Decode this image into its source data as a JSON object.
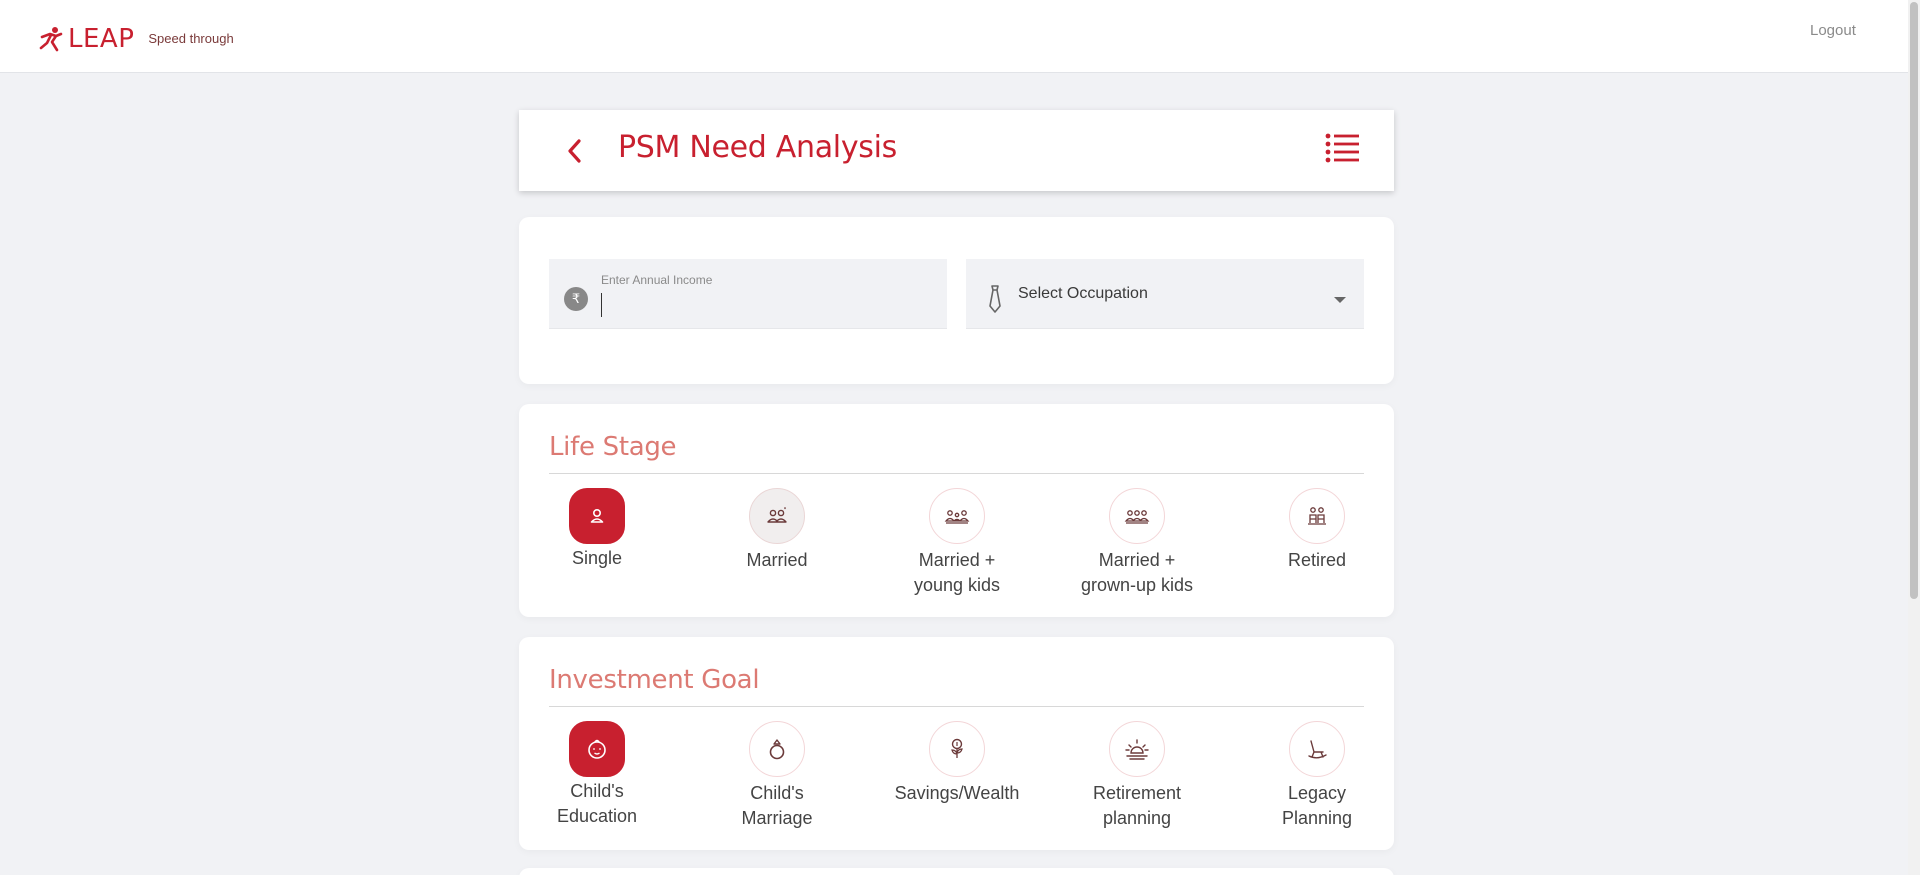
{
  "app": {
    "brand": "LEAP",
    "tagline": "Speed through",
    "logout_label": "Logout",
    "brand_color": "#c8202f"
  },
  "header": {
    "title": "PSM Need Analysis",
    "back_icon": "chevron-left-icon",
    "menu_icon": "list-menu-icon"
  },
  "income": {
    "label": "Enter Annual Income",
    "value": "",
    "currency_symbol": "₹"
  },
  "occupation": {
    "selected": "Select Occupation",
    "icon": "tie-icon"
  },
  "life_stage": {
    "title": "Life Stage",
    "options": [
      {
        "line1": "Single",
        "line2": "",
        "icon": "person-icon",
        "selected": true
      },
      {
        "line1": "Married",
        "line2": "",
        "icon": "couple-icon",
        "selected": false
      },
      {
        "line1": "Married +",
        "line2": "young kids",
        "icon": "family-young-kids-icon",
        "selected": false
      },
      {
        "line1": "Married +",
        "line2": "grown-up kids",
        "icon": "family-grown-kids-icon",
        "selected": false
      },
      {
        "line1": "Retired",
        "line2": "",
        "icon": "elderly-couple-icon",
        "selected": false
      }
    ]
  },
  "investment_goal": {
    "title": "Investment Goal",
    "options": [
      {
        "line1": "Child's",
        "line2": "Education",
        "icon": "child-face-icon",
        "selected": true
      },
      {
        "line1": "Child's",
        "line2": "Marriage",
        "icon": "ring-icon",
        "selected": false
      },
      {
        "line1": "Savings/Wealth",
        "line2": "",
        "icon": "money-plant-icon",
        "selected": false
      },
      {
        "line1": "Retirement",
        "line2": "planning",
        "icon": "sunset-icon",
        "selected": false
      },
      {
        "line1": "Legacy",
        "line2": "Planning",
        "icon": "rocking-chair-icon",
        "selected": false
      }
    ]
  }
}
